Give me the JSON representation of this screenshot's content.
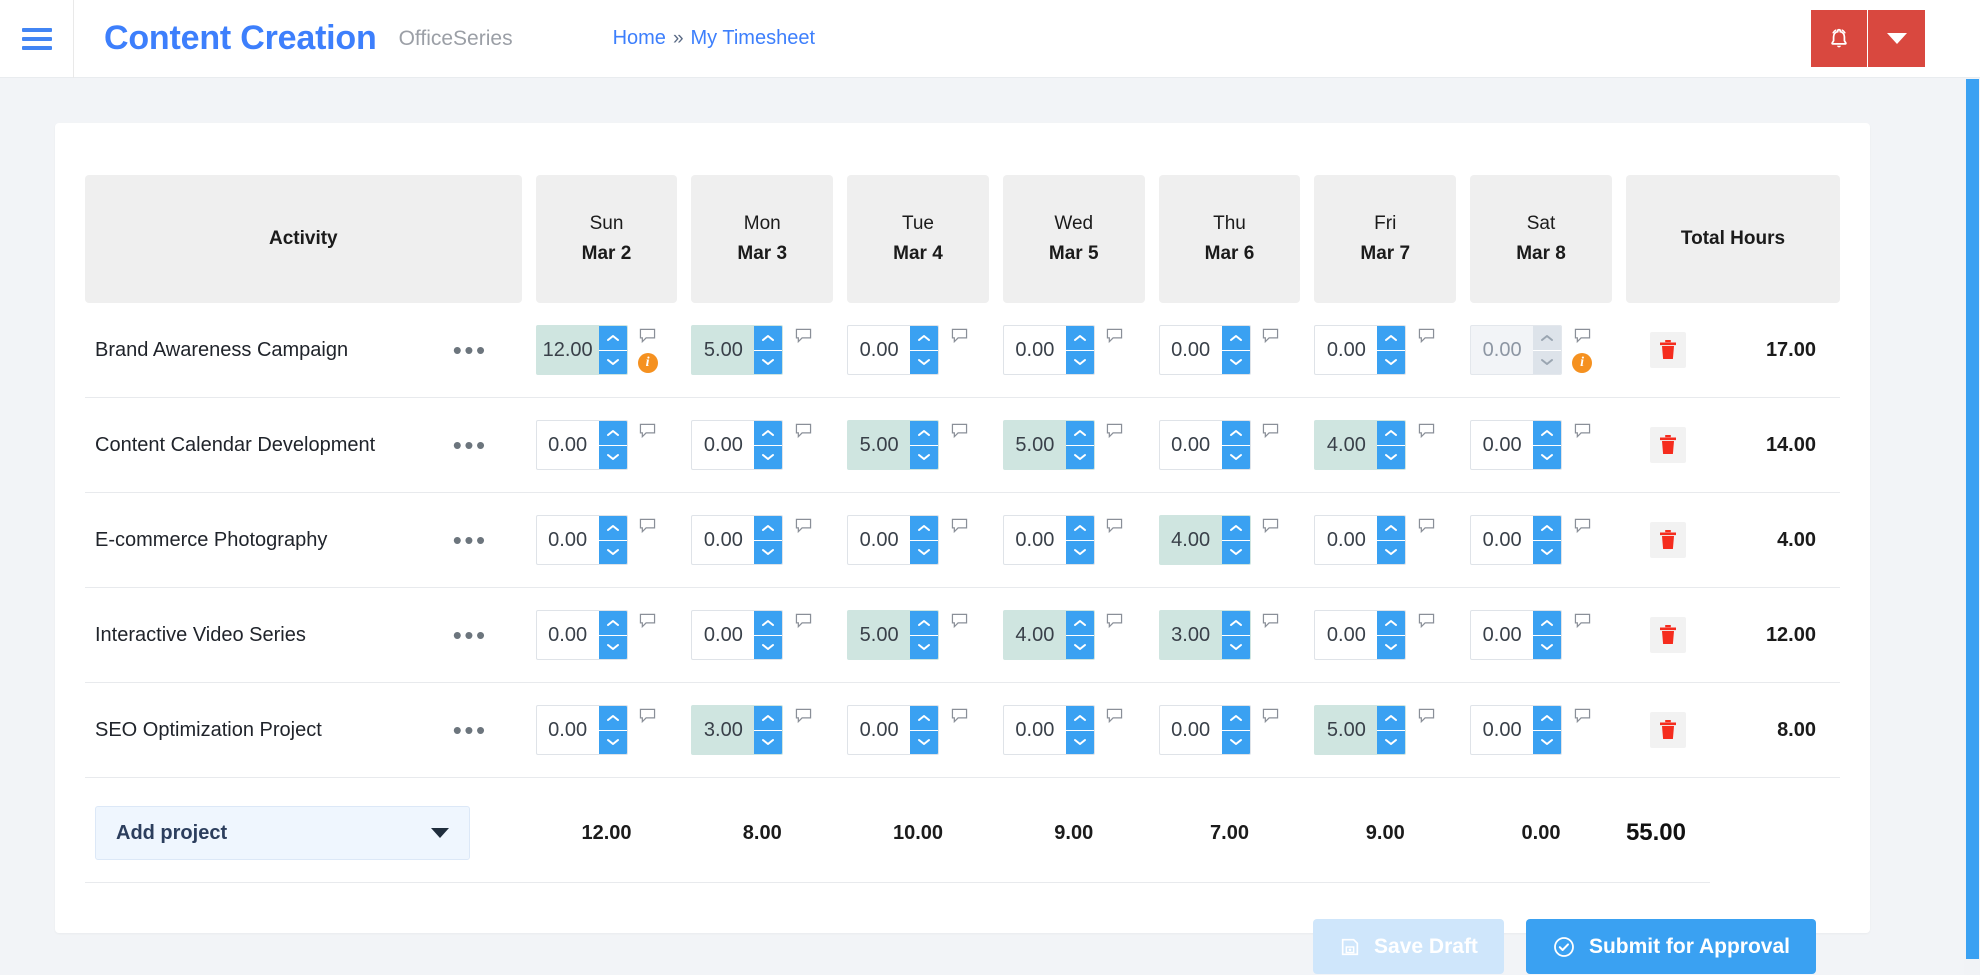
{
  "header": {
    "menu_icon": "hamburger-icon",
    "title": "Content Creation",
    "subtitle": "OfficeSeries",
    "breadcrumb": {
      "home": "Home",
      "separator": "»",
      "current": "My Timesheet"
    },
    "notification_icon": "bell-icon",
    "dropdown_icon": "chevron-down-icon",
    "accent_color": "#3d7ffc",
    "alert_color": "#d9483f"
  },
  "table": {
    "activity_header": "Activity",
    "total_header": "Total Hours",
    "days": [
      {
        "name": "Sun",
        "date": "Mar 2"
      },
      {
        "name": "Mon",
        "date": "Mar 3"
      },
      {
        "name": "Tue",
        "date": "Mar 4"
      },
      {
        "name": "Wed",
        "date": "Mar 5"
      },
      {
        "name": "Thu",
        "date": "Mar 6"
      },
      {
        "name": "Fri",
        "date": "Mar 7"
      },
      {
        "name": "Sat",
        "date": "Mar 8"
      }
    ],
    "rows": [
      {
        "activity": "Brand Awareness Campaign",
        "hours": [
          "12.00",
          "5.00",
          "0.00",
          "0.00",
          "0.00",
          "0.00",
          "0.00"
        ],
        "filled": [
          true,
          true,
          false,
          false,
          false,
          false,
          false
        ],
        "disabled": [
          false,
          false,
          false,
          false,
          false,
          false,
          true
        ],
        "info": [
          true,
          false,
          false,
          false,
          false,
          false,
          true
        ],
        "total": "17.00"
      },
      {
        "activity": "Content Calendar Development",
        "hours": [
          "0.00",
          "0.00",
          "5.00",
          "5.00",
          "0.00",
          "4.00",
          "0.00"
        ],
        "filled": [
          false,
          false,
          true,
          true,
          false,
          true,
          false
        ],
        "disabled": [
          false,
          false,
          false,
          false,
          false,
          false,
          false
        ],
        "info": [
          false,
          false,
          false,
          false,
          false,
          false,
          false
        ],
        "total": "14.00"
      },
      {
        "activity": "E-commerce Photography",
        "hours": [
          "0.00",
          "0.00",
          "0.00",
          "0.00",
          "4.00",
          "0.00",
          "0.00"
        ],
        "filled": [
          false,
          false,
          false,
          false,
          true,
          false,
          false
        ],
        "disabled": [
          false,
          false,
          false,
          false,
          false,
          false,
          false
        ],
        "info": [
          false,
          false,
          false,
          false,
          false,
          false,
          false
        ],
        "total": "4.00"
      },
      {
        "activity": "Interactive Video Series",
        "hours": [
          "0.00",
          "0.00",
          "5.00",
          "4.00",
          "3.00",
          "0.00",
          "0.00"
        ],
        "filled": [
          false,
          false,
          true,
          true,
          true,
          false,
          false
        ],
        "disabled": [
          false,
          false,
          false,
          false,
          false,
          false,
          false
        ],
        "info": [
          false,
          false,
          false,
          false,
          false,
          false,
          false
        ],
        "total": "12.00"
      },
      {
        "activity": "SEO Optimization Project",
        "hours": [
          "0.00",
          "3.00",
          "0.00",
          "0.00",
          "0.00",
          "5.00",
          "0.00"
        ],
        "filled": [
          false,
          true,
          false,
          false,
          false,
          true,
          false
        ],
        "disabled": [
          false,
          false,
          false,
          false,
          false,
          false,
          false
        ],
        "info": [
          false,
          false,
          false,
          false,
          false,
          false,
          false
        ],
        "total": "8.00"
      }
    ],
    "column_totals": [
      "12.00",
      "8.00",
      "10.00",
      "9.00",
      "7.00",
      "9.00",
      "0.00"
    ],
    "grand_total": "55.00",
    "row_menu_icon": "kebab-menu-icon",
    "delete_icon": "trash-icon",
    "comment_icon": "comment-icon",
    "info_icon": "info-icon",
    "filled_cell_color": "#cfe5e0",
    "spinner_color": "#3aa1f2"
  },
  "footer": {
    "add_project_label": "Add project",
    "save_draft_label": "Save Draft",
    "submit_label": "Submit for Approval",
    "save_icon": "save-icon",
    "submit_icon": "check-circle-icon"
  }
}
